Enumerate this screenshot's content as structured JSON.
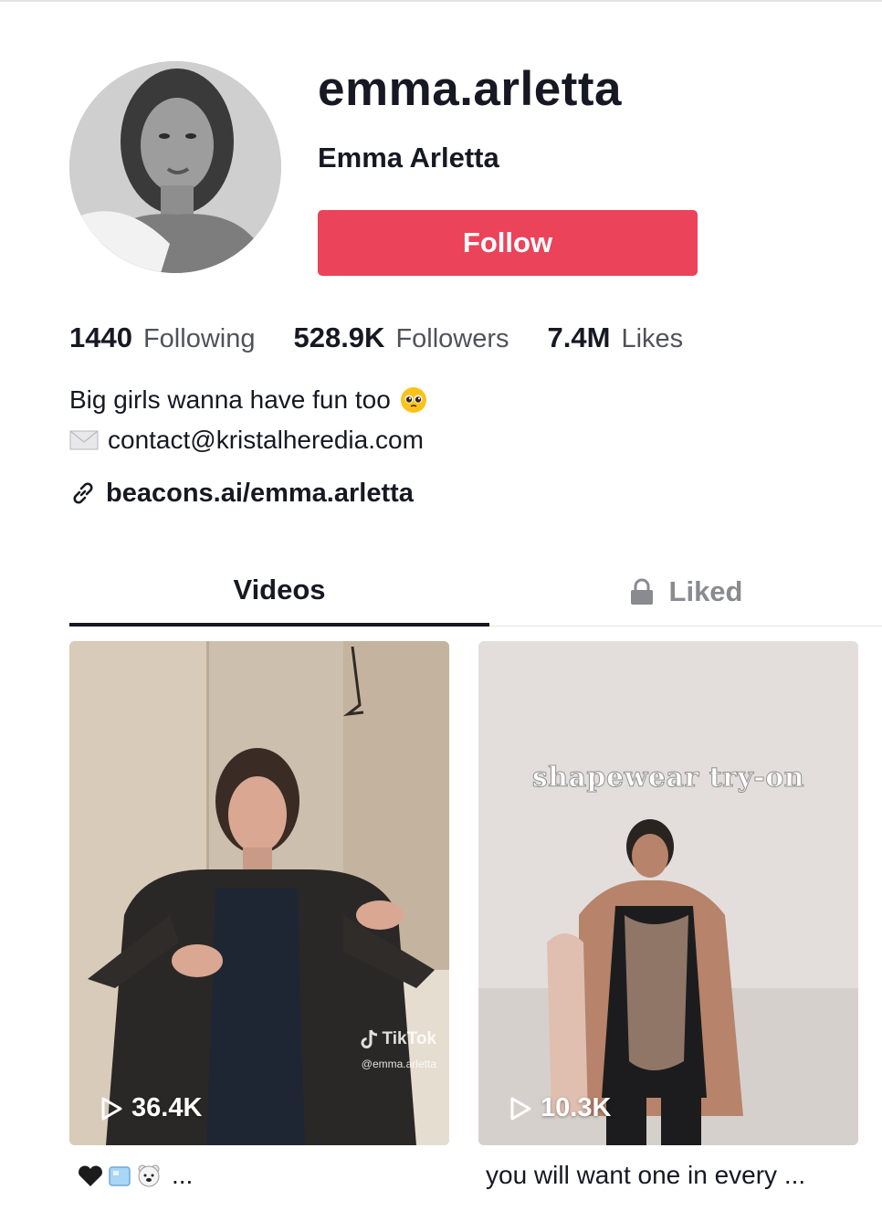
{
  "profile": {
    "username": "emma.arletta",
    "nickname": "Emma Arletta",
    "follow_label": "Follow",
    "avatar_icon": "profile-photo"
  },
  "stats": [
    {
      "value": "1440",
      "label": "Following"
    },
    {
      "value": "528.9K",
      "label": "Followers"
    },
    {
      "value": "7.4M",
      "label": "Likes"
    }
  ],
  "bio": {
    "line1": "Big girls wanna have fun too",
    "line1_emoji": "pleading-face-emoji",
    "line2": "contact@kristalheredia.com",
    "line2_icon": "envelope-icon",
    "link": "beacons.ai/emma.arletta",
    "link_icon": "link-icon"
  },
  "tabs": {
    "videos": "Videos",
    "liked": "Liked",
    "liked_icon": "lock-icon"
  },
  "videos": [
    {
      "views": "36.4K",
      "caption_suffix": "...",
      "caption_emojis": [
        "black-heart-emoji",
        "ice-cube-emoji",
        "polar-bear-emoji"
      ],
      "watermark_logo": "TikTok",
      "watermark_handle": "@emma.arletta"
    },
    {
      "views": "10.3K",
      "overlay_text": "shapewear try-on",
      "caption": "you will want one in every ..."
    }
  ],
  "colors": {
    "accent": "#ea435a",
    "text": "#161823",
    "muted": "#8a8b91"
  }
}
